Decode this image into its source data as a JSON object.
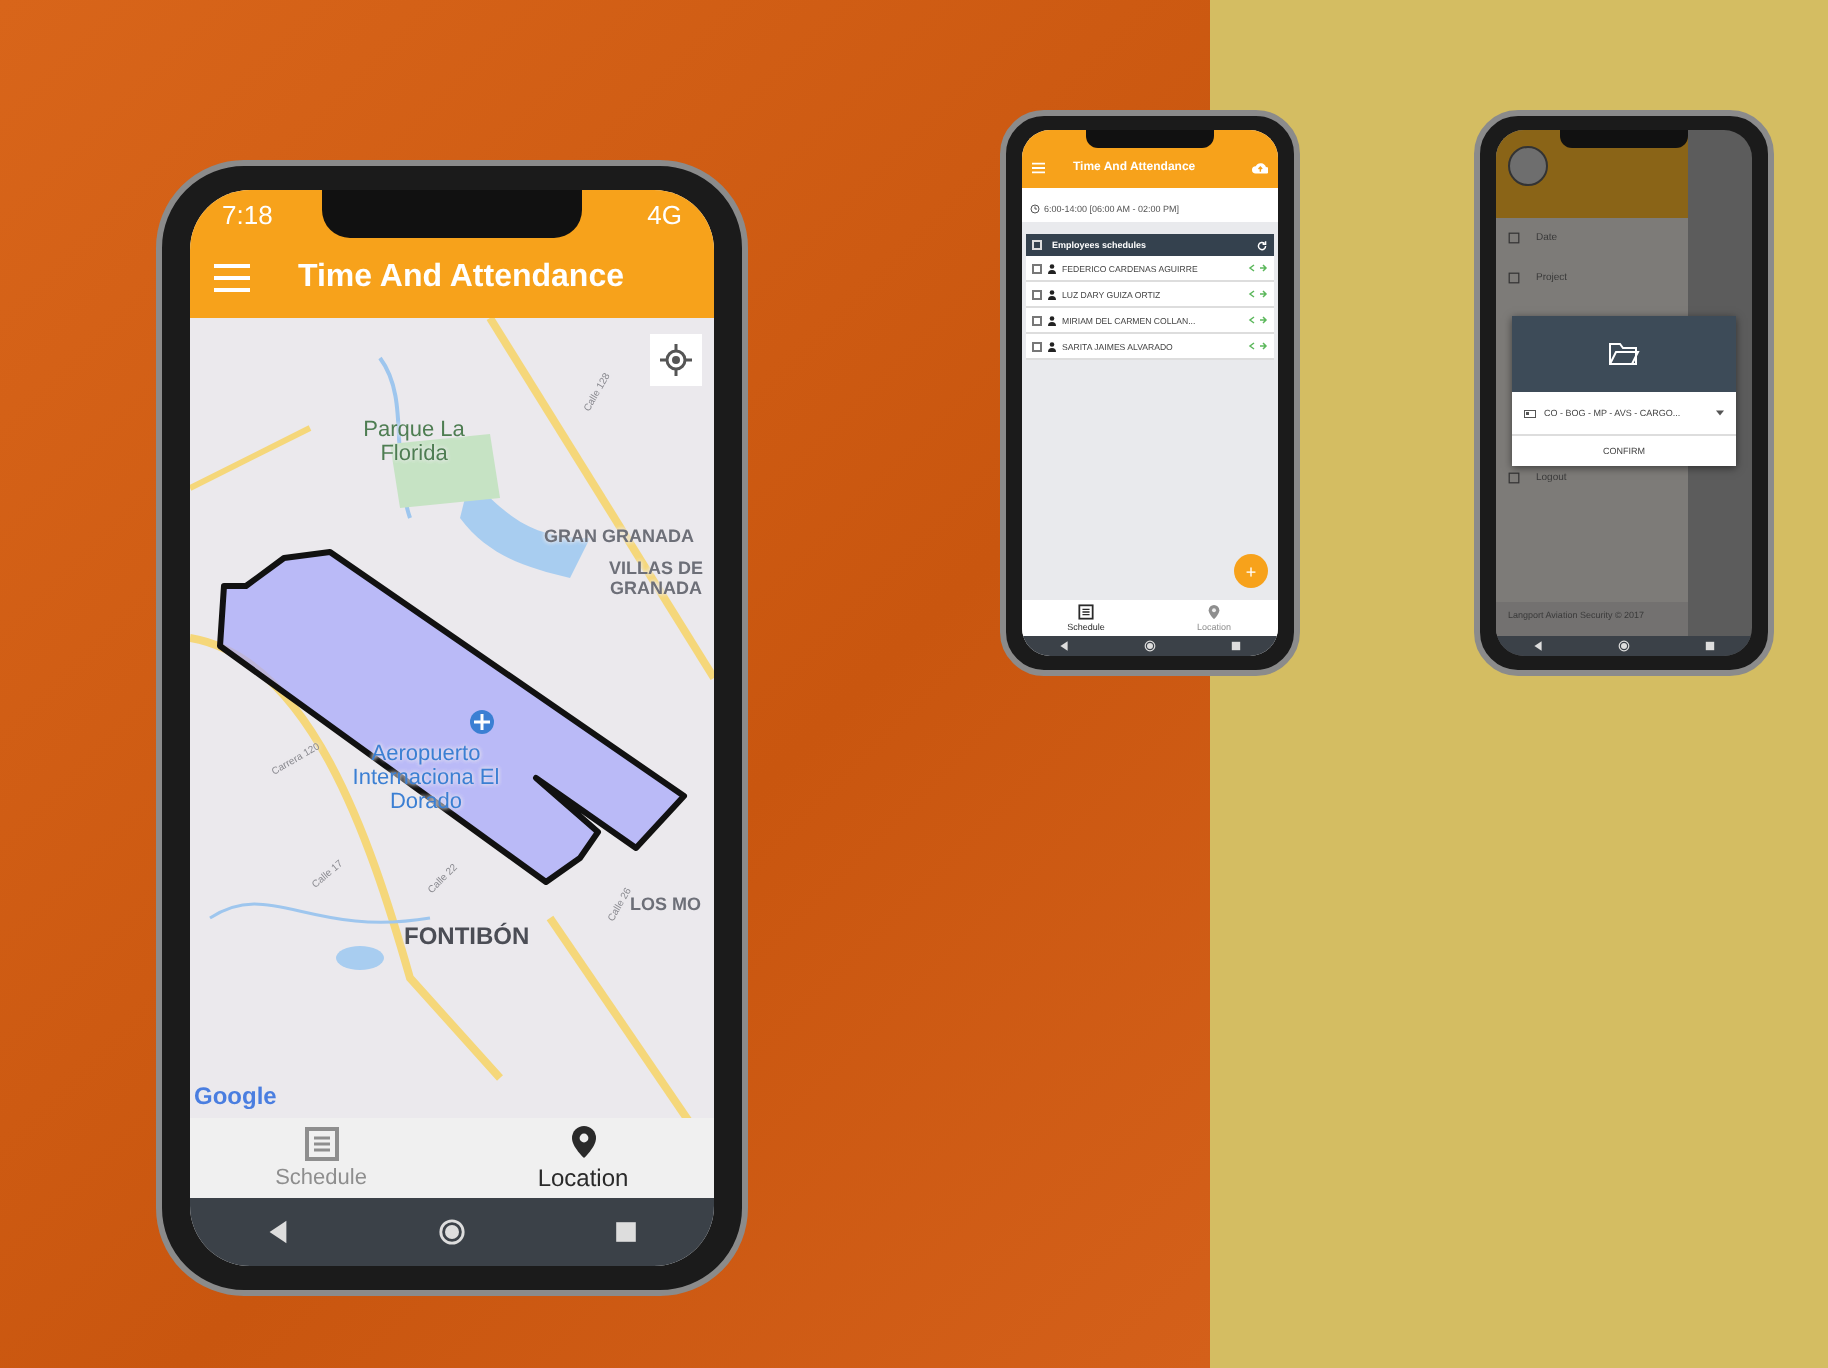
{
  "main_phone": {
    "status_time": "7:18",
    "network": "4G",
    "app_title": "Time And Attendance",
    "map": {
      "labels": [
        {
          "text": "Parque La Florida",
          "kind": "park"
        },
        {
          "text": "GRAN GRANADA",
          "kind": "area"
        },
        {
          "text": "VILLAS DE GRANADA",
          "kind": "area"
        },
        {
          "text": "Aeropuerto Internaciona El Dorado",
          "kind": "airport"
        },
        {
          "text": "FONTIBÓN",
          "kind": "district"
        },
        {
          "text": "LOS MO",
          "kind": "area"
        },
        {
          "text": "Calle 128",
          "kind": "street"
        },
        {
          "text": "Carrera 120",
          "kind": "street"
        },
        {
          "text": "Calle 17",
          "kind": "street"
        },
        {
          "text": "Calle 22",
          "kind": "street"
        },
        {
          "text": "Calle 26",
          "kind": "street"
        }
      ],
      "attribution": "Google"
    },
    "nav": [
      {
        "label": "Schedule",
        "selected": false
      },
      {
        "label": "Location",
        "selected": true
      }
    ]
  },
  "schedule_phone": {
    "app_title": "Time And Attendance",
    "shift": "6:00-14:00 [06:00 AM - 02:00 PM]",
    "list_title": "Employees schedules",
    "all_checked": false,
    "employees": [
      {
        "name": "FEDERICO CARDENAS AGUIRRE",
        "checked": false
      },
      {
        "name": "LUZ DARY GUIZA ORTIZ",
        "checked": false
      },
      {
        "name": "MIRIAM DEL CARMEN COLLAN...",
        "checked": false
      },
      {
        "name": "SARITA JAIMES ALVARADO",
        "checked": false
      }
    ],
    "fab": "+",
    "nav": [
      {
        "label": "Schedule",
        "selected": true
      },
      {
        "label": "Location",
        "selected": false
      }
    ]
  },
  "project_phone": {
    "drawer_items": [
      "Date",
      "Project",
      "Logout"
    ],
    "footer": "Langport Aviation Security © 2017",
    "dialog": {
      "project": "CO - BOG - MP - AVS - CARGO...",
      "button": "CONFIRM"
    }
  }
}
